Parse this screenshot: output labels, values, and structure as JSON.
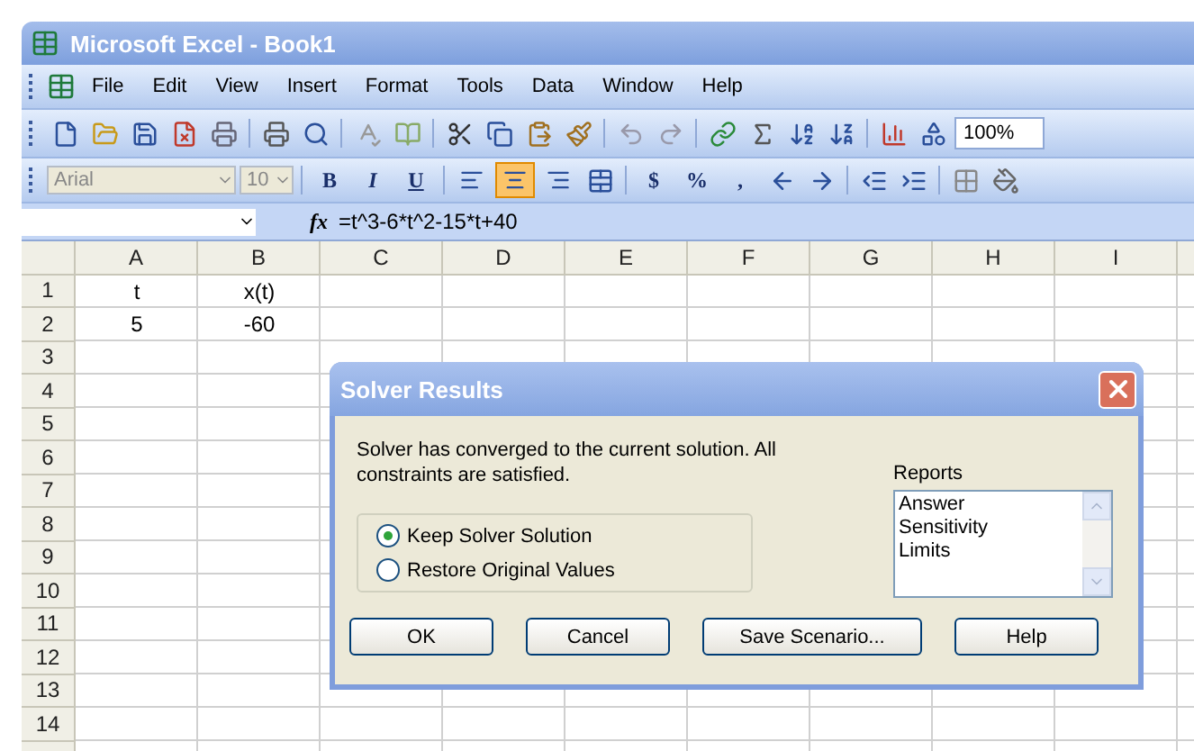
{
  "window": {
    "title": "Microsoft Excel - Book1"
  },
  "menu": [
    "File",
    "Edit",
    "View",
    "Insert",
    "Format",
    "Tools",
    "Data",
    "Window",
    "Help"
  ],
  "standard_toolbar": {
    "zoom": "100%"
  },
  "formatting_toolbar": {
    "font": "Arial",
    "size": "10",
    "styles": [
      "B",
      "I",
      "U"
    ],
    "alignments": [
      {
        "kind": "left",
        "selected": false
      },
      {
        "kind": "center",
        "selected": true
      },
      {
        "kind": "right",
        "selected": false
      }
    ],
    "number_formats": [
      "$",
      "%",
      ","
    ]
  },
  "formula_bar": {
    "function_label": "fx",
    "formula": "=t^3-6*t^2-15*t+40"
  },
  "sheet": {
    "columns": [
      "A",
      "B",
      "C",
      "D",
      "E",
      "F",
      "G",
      "H",
      "I"
    ],
    "rows": [
      {
        "number": "1",
        "cells": [
          "t",
          "x(t)"
        ]
      },
      {
        "number": "2",
        "cells": [
          "5",
          "-60"
        ]
      },
      {
        "number": "3"
      },
      {
        "number": "4"
      },
      {
        "number": "5"
      },
      {
        "number": "6"
      },
      {
        "number": "7"
      },
      {
        "number": "8"
      },
      {
        "number": "9"
      },
      {
        "number": "10"
      },
      {
        "number": "11"
      },
      {
        "number": "12"
      },
      {
        "number": "13"
      },
      {
        "number": "14"
      }
    ]
  },
  "dialog": {
    "title": "Solver Results",
    "message": "Solver has converged to the current solution.  All constraints are satisfied.",
    "options": [
      {
        "label": "Keep Solver Solution",
        "selected": true
      },
      {
        "label": "Restore Original Values",
        "selected": false
      }
    ],
    "reports_label": "Reports",
    "reports": [
      "Answer",
      "Sensitivity",
      "Limits"
    ],
    "buttons": [
      "OK",
      "Cancel",
      "Save Scenario...",
      "Help"
    ]
  }
}
